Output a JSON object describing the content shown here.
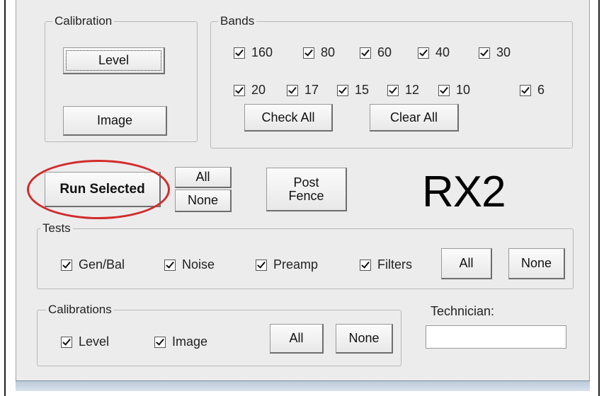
{
  "calibration_group": {
    "legend": "Calibration",
    "level_button": "Level",
    "image_button": "Image"
  },
  "bands_group": {
    "legend": "Bands",
    "row1": [
      "160",
      "80",
      "60",
      "40",
      "30"
    ],
    "row2": [
      "20",
      "17",
      "15",
      "12",
      "10",
      "6"
    ],
    "check_all_button": "Check All",
    "clear_all_button": "Clear All"
  },
  "run_selected_button": "Run Selected",
  "all_button": "All",
  "none_button": "None",
  "post_fence_button": "Post\nFence",
  "radio_label": "RX2",
  "tests_group": {
    "legend": "Tests",
    "items": [
      "Gen/Bal",
      "Noise",
      "Preamp",
      "Filters"
    ],
    "all_button": "All",
    "none_button": "None"
  },
  "calibrations_group": {
    "legend": "Calibrations",
    "items": [
      "Level",
      "Image"
    ],
    "all_button": "All",
    "none_button": "None"
  },
  "technician": {
    "label": "Technician:",
    "value": ""
  },
  "colors": {
    "highlight": "#d22b2b",
    "window_bg": "#ececec"
  }
}
